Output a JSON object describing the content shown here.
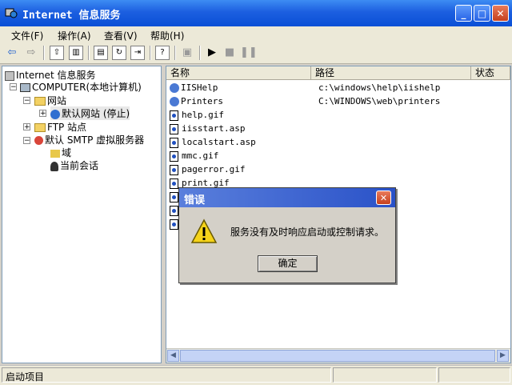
{
  "window": {
    "title": "Internet 信息服务",
    "minimize": "_",
    "maximize": "□",
    "close": "✕"
  },
  "menu": [
    "文件(F)",
    "操作(A)",
    "查看(V)",
    "帮助(H)"
  ],
  "tree": {
    "root": "Internet 信息服务",
    "computer": "COMPUTER(本地计算机)",
    "websites": "网站",
    "default_site": "默认网站 (停止)",
    "ftp": "FTP 站点",
    "smtp": "默认 SMTP 虚拟服务器",
    "domain": "域",
    "sessions": "当前会话"
  },
  "list": {
    "columns": [
      "名称",
      "路径",
      "状态"
    ],
    "rows": [
      {
        "name": "IISHelp",
        "path": "c:\\windows\\help\\iishelp"
      },
      {
        "name": "Printers",
        "path": "C:\\WINDOWS\\web\\printers"
      },
      {
        "name": "help.gif",
        "path": ""
      },
      {
        "name": "iisstart.asp",
        "path": ""
      },
      {
        "name": "localstart.asp",
        "path": ""
      },
      {
        "name": "mmc.gif",
        "path": ""
      },
      {
        "name": "pagerror.gif",
        "path": ""
      },
      {
        "name": "print.gif",
        "path": ""
      }
    ]
  },
  "status": {
    "text": "启动项目"
  },
  "dialog": {
    "title": "错误",
    "message": "服务没有及时响应启动或控制请求。",
    "ok": "确定"
  }
}
